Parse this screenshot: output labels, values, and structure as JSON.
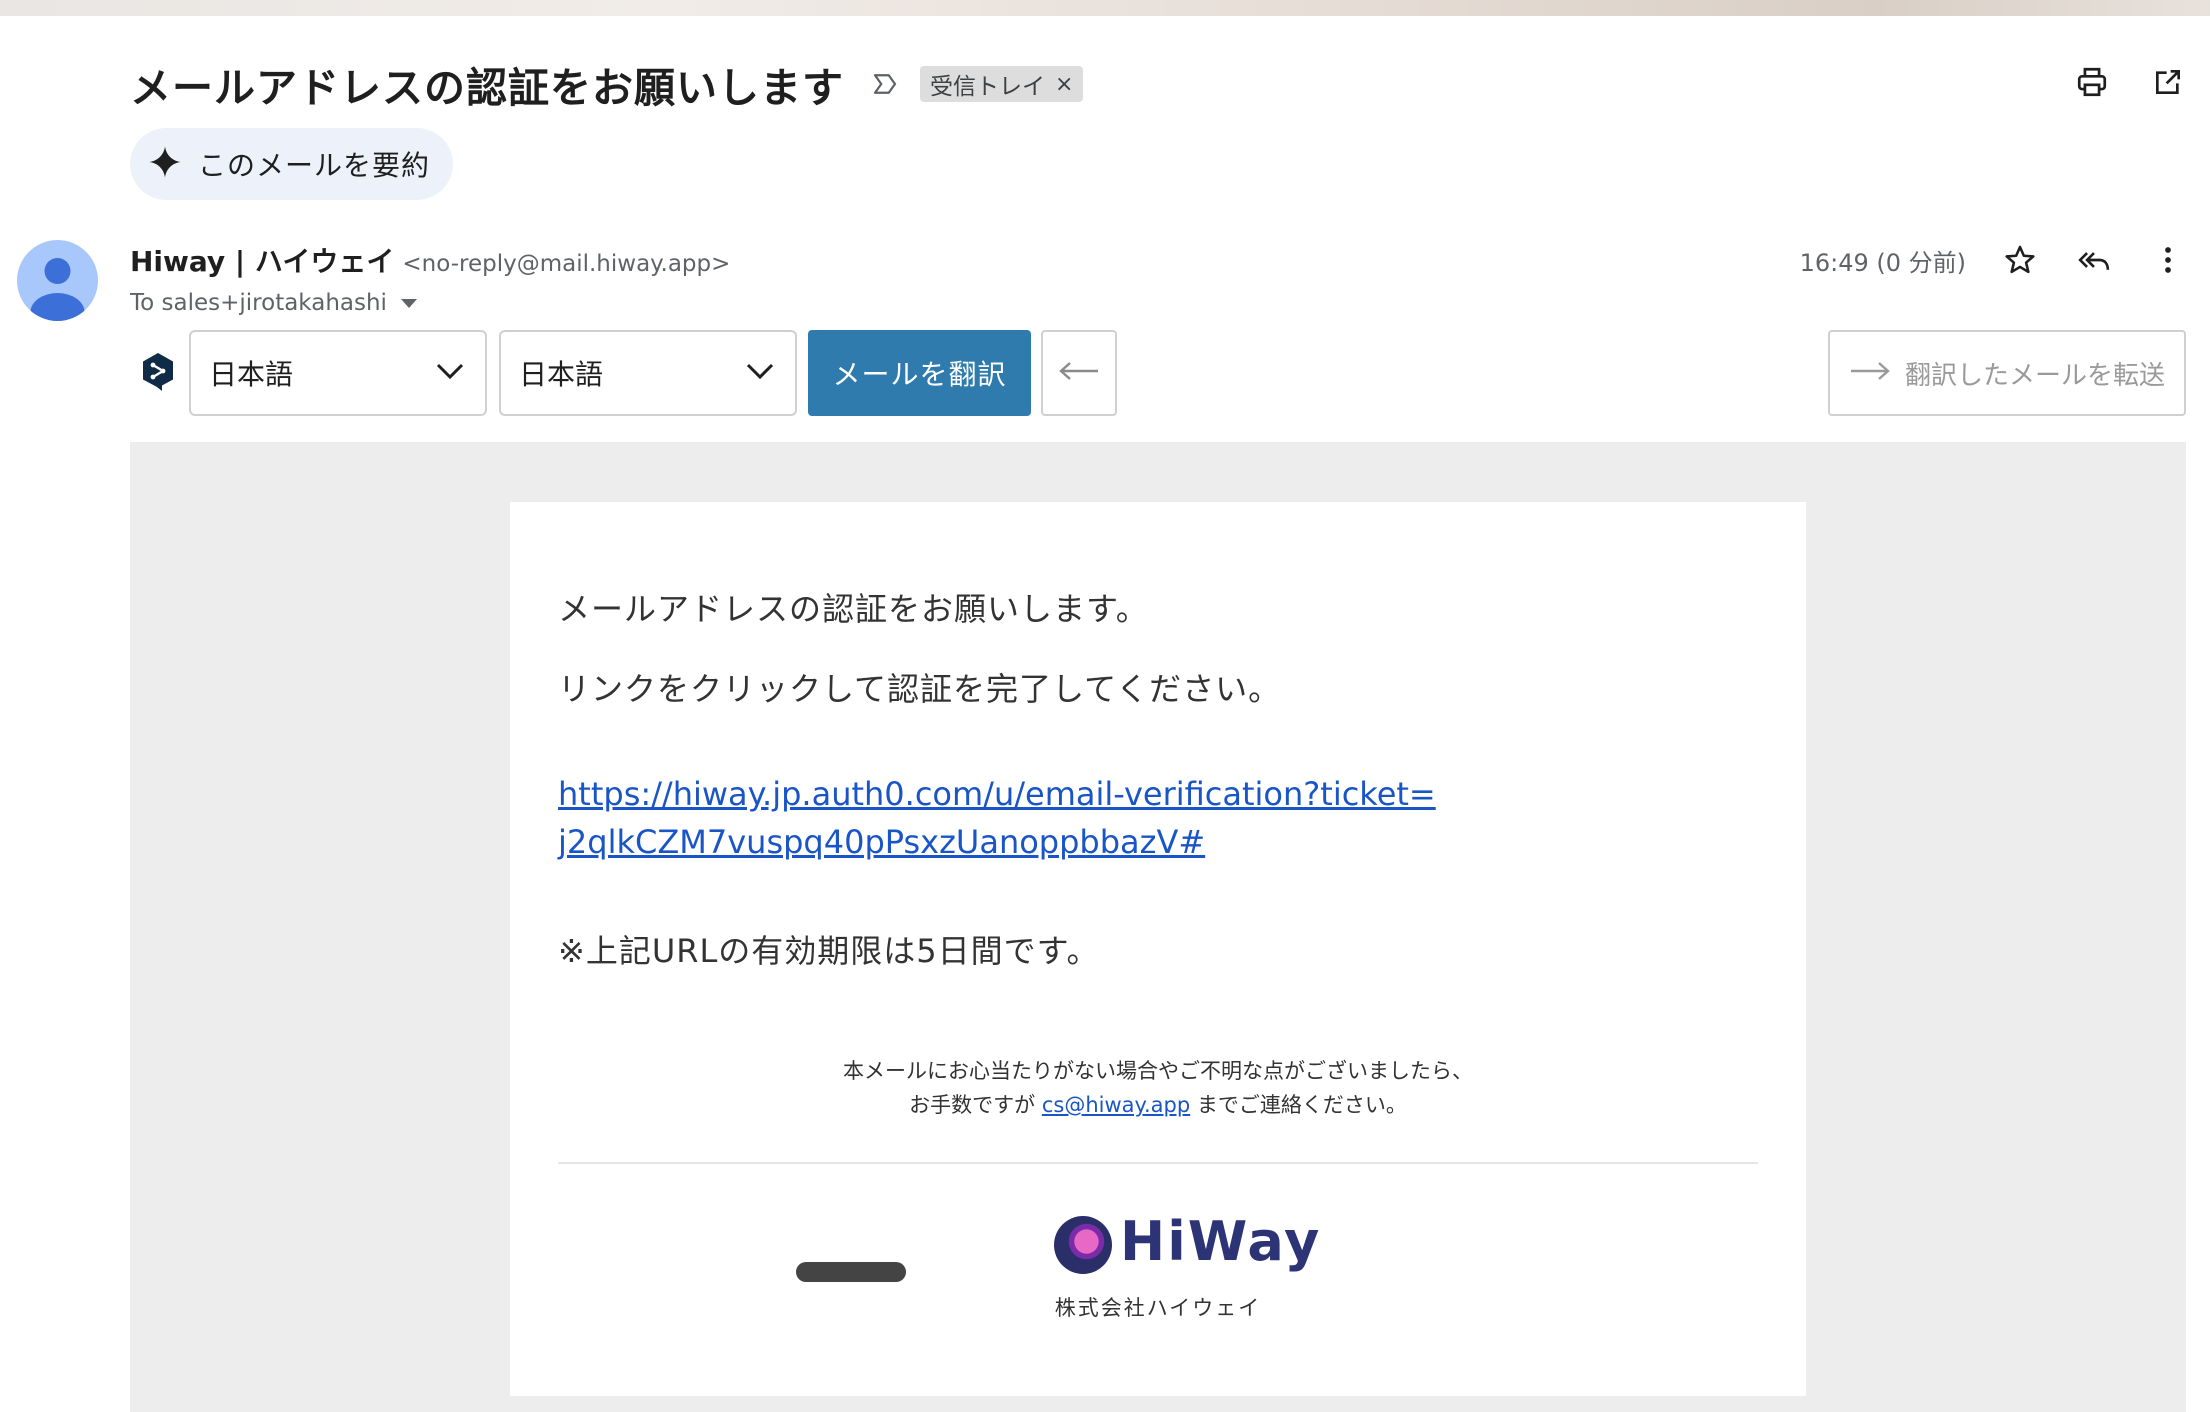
{
  "subject": "メールアドレスの認証をお願いします",
  "label_chip": {
    "label": "受信トレイ",
    "close": "×"
  },
  "summary_button": {
    "label": "このメールを要約"
  },
  "sender": {
    "name": "Hiway | ハイウェイ",
    "email": "<no-reply@mail.hiway.app>",
    "to": "To sales+jirotakahashi"
  },
  "time": "16:49 (0 分前)",
  "translate_bar": {
    "source_lang": "日本語",
    "target_lang": "日本語",
    "translate_label": "メールを翻訳",
    "forward_label": "翻訳したメールを転送"
  },
  "email_body": {
    "line1": "メールアドレスの認証をお願いします。",
    "line2": "リンクをクリックして認証を完了してください。",
    "link_line1": "https://hiway.jp.auth0.com/u/email-verification?ticket=",
    "link_line2": "j2qlkCZM7vuspq40pPsxzUanoppbbazV#",
    "line3": "※上記URLの有効期限は5日間です。",
    "footer_line1": "本メールにお心当たりがない場合やご不明な点がございましたら、",
    "footer_line2_prefix": "お手数ですが ",
    "footer_email": "cs@hiway.app",
    "footer_line2_suffix": " までご連絡ください。",
    "logo_text": "HiWay",
    "company": "株式会社ハイウェイ"
  },
  "icons": {
    "important": "label-important-icon",
    "print": "print-icon",
    "open_new": "open-in-new-icon",
    "sparkle": "sparkle-icon",
    "star": "star-icon",
    "reply_all": "reply-all-icon",
    "more": "more-vert-icon",
    "deepl": "deepl-logo-icon"
  },
  "colors": {
    "translate_button": "#2f7bad",
    "link": "#1a55c8",
    "avatar": "#a8c7fa",
    "mail_background": "#ededed",
    "summary_pill": "#edf2fa"
  }
}
